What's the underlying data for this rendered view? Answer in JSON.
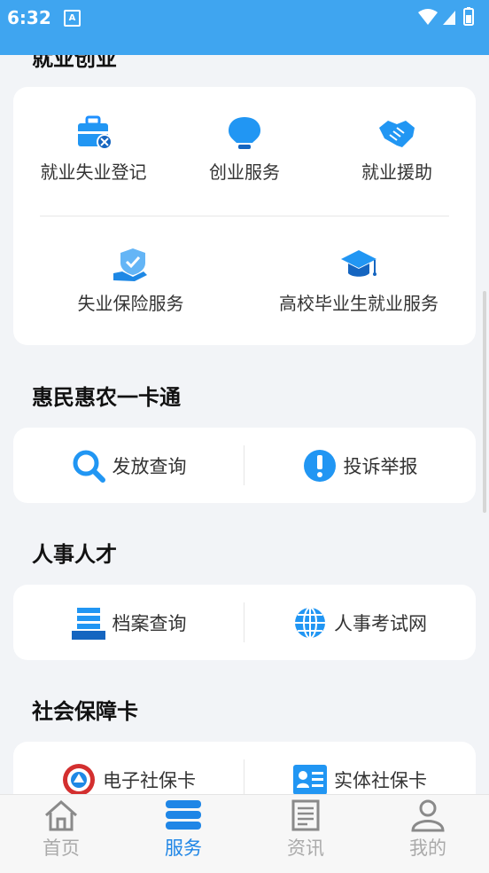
{
  "status_bar": {
    "time": "6:32",
    "notification_letter": "A"
  },
  "sections": {
    "employment": {
      "title": "就业创业",
      "items": [
        "就业失业登记",
        "创业服务",
        "就业援助",
        "失业保险服务",
        "高校毕业生就业服务"
      ]
    },
    "huimin": {
      "title": "惠民惠农一卡通",
      "items": [
        "发放查询",
        "投诉举报"
      ]
    },
    "personnel": {
      "title": "人事人才",
      "items": [
        "档案查询",
        "人事考试网"
      ]
    },
    "social_card": {
      "title": "社会保障卡",
      "items": [
        "电子社保卡",
        "实体社保卡"
      ]
    }
  },
  "tabbar": {
    "tabs": [
      "首页",
      "服务",
      "资讯",
      "我的"
    ],
    "active": "服务"
  },
  "colors": {
    "accent": "#3fa5f0",
    "active_tab": "#1f86e6",
    "icon_blue": "#1e90ff"
  }
}
